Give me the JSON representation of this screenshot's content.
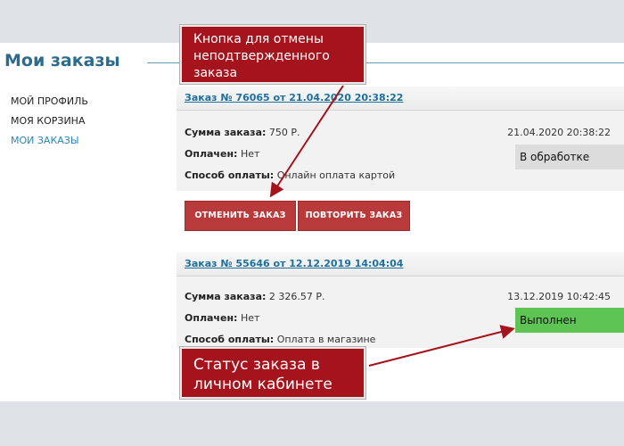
{
  "page": {
    "title": "Мои заказы"
  },
  "nav": [
    "МОЙ ПРОФИЛЬ",
    "МОЯ КОРЗИНА",
    "МОИ ЗАКАЗЫ"
  ],
  "orders": [
    {
      "link": "Заказ № 76065 от 21.04.2020 20:38:22",
      "sum_label": "Сумма заказа:",
      "sum_value": "750 Р.",
      "paid_label": "Оплачен:",
      "paid_value": "Нет",
      "pay_label": "Способ оплаты:",
      "pay_value": "Онлайн оплата картой",
      "date": "21.04.2020 20:38:22",
      "status": "В обработке",
      "status_color": "#dcdcdc",
      "cancel_label": "ОТМЕНИТЬ ЗАКАЗ",
      "repeat_label": "ПОВТОРИТЬ ЗАКАЗ"
    },
    {
      "link": "Заказ № 55646 от 12.12.2019 14:04:04",
      "sum_label": "Сумма заказа:",
      "sum_value": "2 326.57 Р.",
      "paid_label": "Оплачен:",
      "paid_value": "Нет",
      "pay_label": "Способ оплаты:",
      "pay_value": "Оплата в магазине",
      "date": "13.12.2019 10:42:45",
      "status": "Выполнен",
      "status_color": "#5ec453"
    }
  ],
  "callouts": {
    "cancel_hint": "Кнопка для отмены неподтвержденного заказа",
    "status_hint": "Статус заказа в личном кабинете"
  },
  "colors": {
    "accent": "#2b6b8e",
    "button": "#b83a3a",
    "callout": "#a5141c"
  }
}
